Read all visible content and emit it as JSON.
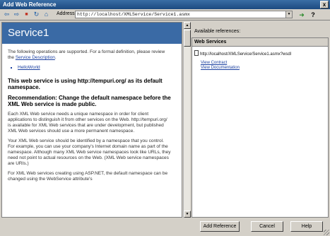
{
  "window": {
    "title": "Add Web Reference",
    "close_glyph": "x"
  },
  "toolbar": {
    "back_glyph": "⇦",
    "forward_glyph": "⇨",
    "stop_glyph": "■",
    "refresh_glyph": "↻",
    "home_glyph": "⌂",
    "address_label": "Address:",
    "address_value": "http://localhost/XMLService/Service1.asmx",
    "go_glyph": "➜",
    "help_glyph": "?"
  },
  "browser": {
    "service_title": "Service1",
    "intro_text": "The following operations are supported. For a formal definition, please review the ",
    "intro_link": "Service Description",
    "intro_end": ".",
    "operations": [
      "HelloWorld"
    ],
    "tempuri_heading": "This web service is using http://tempuri.org/ as its default namespace.",
    "recommendation_heading": "Recommendation: Change the default namespace before the XML Web service is made public.",
    "para1": "Each XML Web service needs a unique namespace in order for client applications to distinguish it from other services on the Web. http://tempuri.org/ is available for XML Web services that are under development, but published XML Web services should use a more permanent namespace.",
    "para2": "Your XML Web service should be identified by a namespace that you control. For example, you can use your company's Internet domain name as part of the namespace. Although many XML Web service namespaces look like URLs, they need not point to actual resources on the Web. (XML Web service namespaces are URIs.)",
    "para3": "For XML Web services creating using ASP.NET, the default namespace can be changed using the WebService attribute's"
  },
  "refs": {
    "available_label": "Available references:",
    "header": "Web Services",
    "reference_url": "http://localhost/XMLService/Service1.asmx?wsdl",
    "view_contract": "View Contract",
    "view_documentation": "View Documentation"
  },
  "buttons": {
    "add_reference": "Add Reference",
    "cancel": "Cancel",
    "help": "Help"
  }
}
